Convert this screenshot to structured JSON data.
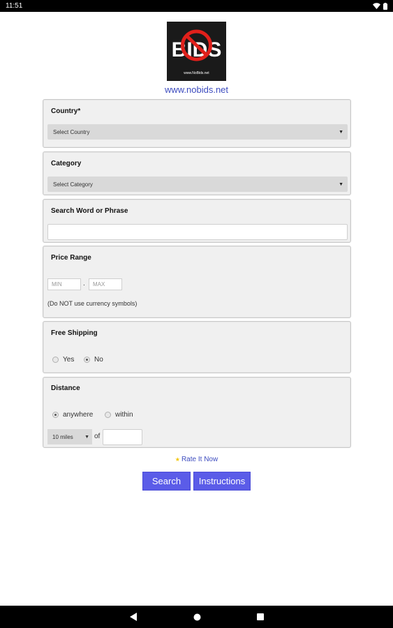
{
  "status_bar": {
    "time": "11:51"
  },
  "logo": {
    "caption": "www.NoBids.net"
  },
  "site_link": "www.nobids.net",
  "country": {
    "label": "Country*",
    "selected": "Select Country"
  },
  "category": {
    "label": "Category",
    "selected": "Select Category"
  },
  "search": {
    "label": "Search Word or Phrase",
    "value": ""
  },
  "price": {
    "label": "Price Range",
    "min_placeholder": "MIN",
    "separator": ".",
    "max_placeholder": "MAX",
    "hint": "(Do NOT use currency symbols)"
  },
  "shipping": {
    "label": "Free Shipping",
    "yes_label": "Yes",
    "no_label": "No",
    "selected": "No"
  },
  "distance": {
    "label": "Distance",
    "anywhere_label": "anywhere",
    "within_label": "within",
    "selected": "anywhere",
    "miles_selected": "10 miles",
    "of_label": "of",
    "zip_value": ""
  },
  "rate_link": "Rate It Now",
  "buttons": {
    "search_label": "Search",
    "instructions_label": "Instructions"
  },
  "colors": {
    "accent": "#5b5ce8",
    "link": "#3d4cbf",
    "panel_bg": "#f0f0f0"
  }
}
